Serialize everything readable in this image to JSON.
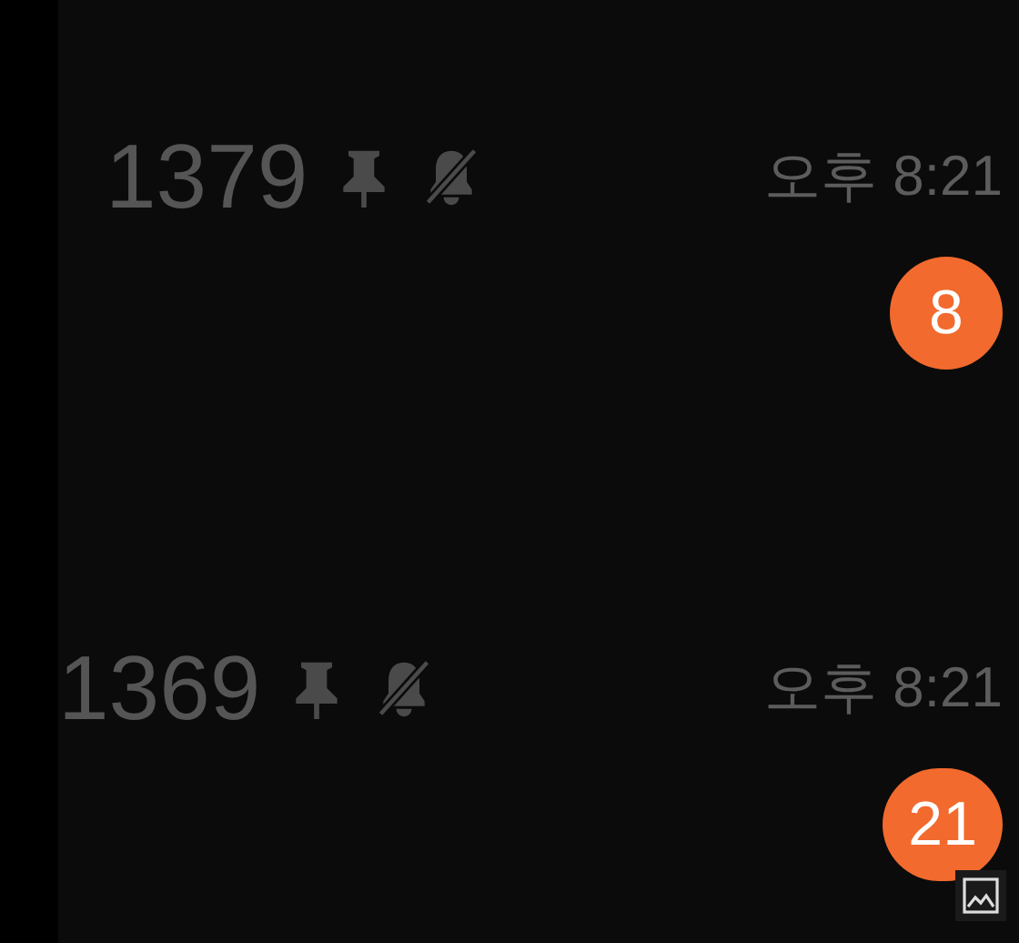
{
  "chats": [
    {
      "title": "1379",
      "pinned": true,
      "muted": true,
      "time": "오후 8:21",
      "unread": "8"
    },
    {
      "title": "1369",
      "pinned": true,
      "muted": true,
      "time": "오후 8:21",
      "unread": "21"
    }
  ]
}
